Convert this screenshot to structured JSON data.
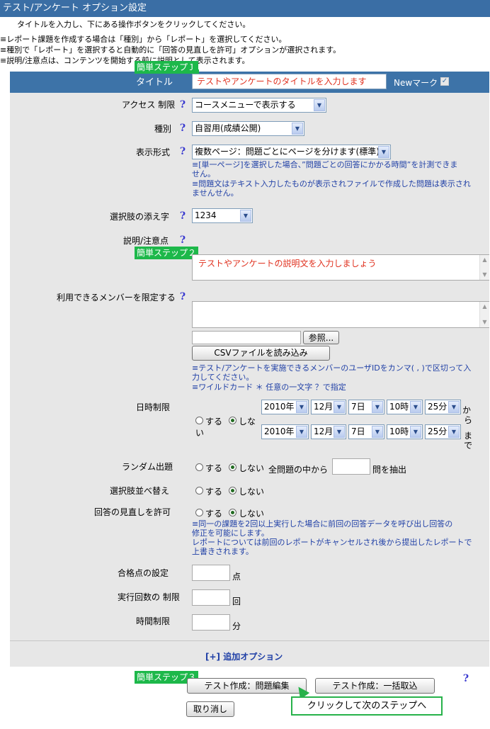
{
  "header": {
    "title": "テスト/アンケート オプション設定"
  },
  "intro": {
    "line1": "タイトルを入力し、下にある操作ボタンをクリックしてください。",
    "line2": "≡レポート課題を作成する場合は「種別」から「レポート」を選択してください。",
    "line3": "≡種別で「レポート」を選択すると自動的に「回答の見直しを許可」オプションが選択されます。",
    "line4": "≡説明/注意点は、コンテンツを開始する前に説明として表示されます。"
  },
  "title_row": {
    "label": "タイトル",
    "input_placeholder": "テストやアンケートのタイトルを入力します",
    "new_mark_label": "Newマーク",
    "new_mark_checked": true
  },
  "steps": {
    "step1": "簡単ステップ１",
    "step2": "簡単ステップ２",
    "step3": "簡単ステップ３"
  },
  "form": {
    "access": {
      "label": "アクセス 制限",
      "value": "コースメニューで表示する"
    },
    "type": {
      "label": "種別",
      "value": "自習用(成績公開)"
    },
    "display": {
      "label": "表示形式",
      "value": "複数ページ：問題ごとにページを分けます(標準)",
      "note1a": "≡[単一ページ]を選択した場合、”問題ごとの回答にかかる時間”を計測できま",
      "note1b": "せん。",
      "note2a": "≡問題文はテキスト入力したものが表示されファイルで作成した問題は表示され",
      "note2b": "ませんせん。"
    },
    "choice_suffix": {
      "label": "選択肢の添え字",
      "value": "1234"
    },
    "description": {
      "label": "説明/注意点",
      "placeholder": "テストやアンケートの説明文を入力しましょう"
    },
    "members": {
      "label": "利用できるメンバーを限定する",
      "browse_label": "参照...",
      "csv_label": "CSVファイルを読み込み",
      "note1a": "≡テスト/アンケートを実施できるメンバーのユーザIDをカンマ( , )で区切って入",
      "note1b": "力してください。",
      "note2": "≡ワイルドカード ＊  任意の一文字 ？で指定"
    },
    "date_limit": {
      "label": "日時制限",
      "radio_on": "する",
      "radio_off": "しな",
      "radio_off_wrap": "い",
      "from": {
        "year": "2010年",
        "month": "12月",
        "day": "7日",
        "hour": "10時",
        "minute": "25分"
      },
      "to": {
        "year": "2010年",
        "month": "12月",
        "day": "7日",
        "hour": "10時",
        "minute": "25分"
      },
      "from_suffix": [
        "か",
        "ら"
      ],
      "to_suffix": [
        "ま",
        "で"
      ],
      "selected": "off"
    },
    "random": {
      "label": "ランダム出題",
      "radio_on": "する",
      "radio_off": "しない",
      "prefix": "全問題の中から",
      "suffix": "問を抽出",
      "selected": "off"
    },
    "shuffle": {
      "label": "選択肢並べ替え",
      "radio_on": "する",
      "radio_off": "しない",
      "selected": "off"
    },
    "review": {
      "label": "回答の見直しを許可",
      "radio_on": "する",
      "radio_off": "しない",
      "selected": "off",
      "note1a": "≡同一の課題を2回以上実行した場合に前回の回答データを呼び出し回答の",
      "note1b": "修正を可能にします。",
      "note2a": "レポートについては前回のレポートがキャンセルされ後から提出したレポートで",
      "note2b": "上書きされます。"
    },
    "pass_score": {
      "label": "合格点の設定",
      "unit": "点"
    },
    "attempts": {
      "label": "実行回数の 制限",
      "unit": "回"
    },
    "time_limit": {
      "label": "時間制限",
      "unit": "分"
    },
    "extra_options": "[+] 追加オプション"
  },
  "buttons": {
    "create_edit": "テスト作成：問題編集",
    "create_import": "テスト作成：一括取込",
    "cancel": "取り消し"
  },
  "callout": "クリックして次のステップへ",
  "colors": {
    "header": "#3a6ea5",
    "panel": "#e7e7e7",
    "note": "#1f3fa6",
    "step": "#1db84a",
    "placeholder": "#e0301e"
  }
}
